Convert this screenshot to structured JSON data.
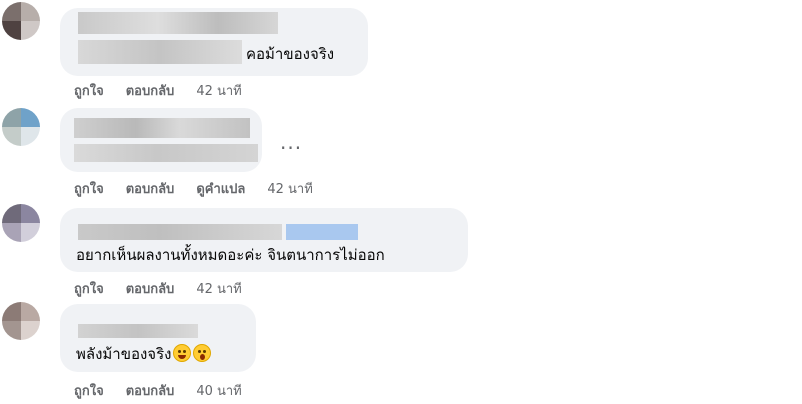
{
  "comments": [
    {
      "text": "คอม้าของจริง",
      "actions": {
        "like": "ถูกใจ",
        "reply": "ตอบกลับ",
        "time": "42 นาที"
      }
    },
    {
      "more": "...",
      "actions": {
        "like": "ถูกใจ",
        "reply": "ตอบกลับ",
        "translate": "ดูคำแปล",
        "time": "42 นาที"
      }
    },
    {
      "text": "อยากเห็นผลงานทั้งหมดอะค่ะ จินตนาการไม่ออก",
      "actions": {
        "like": "ถูกใจ",
        "reply": "ตอบกลับ",
        "time": "42 นาที"
      }
    },
    {
      "text": "พลังม้าของจริง",
      "emojis": [
        "rofl-emoji",
        "shocked-emoji"
      ],
      "actions": {
        "like": "ถูกใจ",
        "reply": "ตอบกลับ",
        "time": "40 นาที"
      }
    }
  ],
  "colors": {
    "bubble": "#f0f2f5",
    "action_text": "#65676b",
    "comment_text": "#050505",
    "blur_link": "#a9c8ef"
  }
}
